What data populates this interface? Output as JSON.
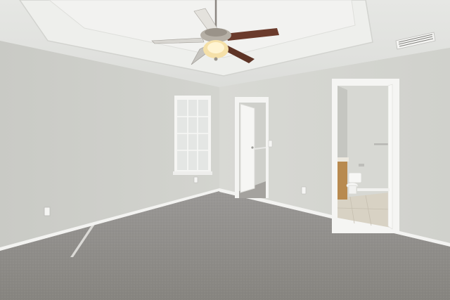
{
  "scene": {
    "description_free": true,
    "colors": {
      "wall_left": "#cfd0cb",
      "wall_back": "#d6d7d2",
      "ceiling": "#e9eae7",
      "carpet": "#8f8d8b",
      "trim": "#f4f4f2",
      "fan_blade": "#6b3b2c",
      "vanity": "#b88a4f",
      "tile": "#d9d3c6"
    }
  }
}
